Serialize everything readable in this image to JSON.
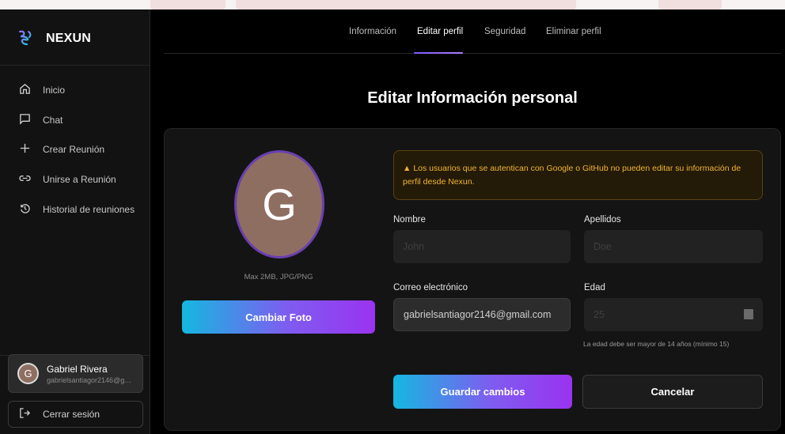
{
  "app": {
    "name": "NEXUN"
  },
  "sidebar": {
    "items": [
      {
        "label": "Inicio",
        "icon": "home-icon"
      },
      {
        "label": "Chat",
        "icon": "chat-icon"
      },
      {
        "label": "Crear Reunión",
        "icon": "plus-icon"
      },
      {
        "label": "Unirse a Reunión",
        "icon": "link-icon"
      },
      {
        "label": "Historial de reuniones",
        "icon": "history-icon"
      }
    ],
    "user": {
      "initial": "G",
      "name": "Gabriel Rivera",
      "email": "gabrielsantiagor2146@gmail.com"
    },
    "logout_label": "Cerrar sesión"
  },
  "tabs": [
    {
      "label": "Información",
      "active": false
    },
    {
      "label": "Editar perfil",
      "active": true
    },
    {
      "label": "Seguridad",
      "active": false
    },
    {
      "label": "Eliminar perfil",
      "active": false
    }
  ],
  "page": {
    "title": "Editar Información personal"
  },
  "photo": {
    "initial": "G",
    "hint": "Max 2MB, JPG/PNG",
    "change_label": "Cambiar Foto"
  },
  "warning": {
    "icon": "warning-icon",
    "text": "Los usuarios que se autentican con Google o GitHub no pueden editar su información de perfil desde Nexun."
  },
  "form": {
    "nombre": {
      "label": "Nombre",
      "placeholder": "John",
      "value": ""
    },
    "apellidos": {
      "label": "Apellidos",
      "placeholder": "Doe",
      "value": ""
    },
    "correo": {
      "label": "Correo electrónico",
      "value": "gabrielsantiagor2146@gmail.com"
    },
    "edad": {
      "label": "Edad",
      "placeholder": "25",
      "value": "",
      "hint": "La edad debe ser mayor de 14 años (mínimo 15)"
    }
  },
  "actions": {
    "save_label": "Guardar cambios",
    "cancel_label": "Cancelar"
  },
  "colors": {
    "accent_start": "#14b8e0",
    "accent_end": "#9a33f0",
    "warning": "#f0b632",
    "avatar": "#8f6e62",
    "avatar_ring": "#6a3fb0"
  }
}
